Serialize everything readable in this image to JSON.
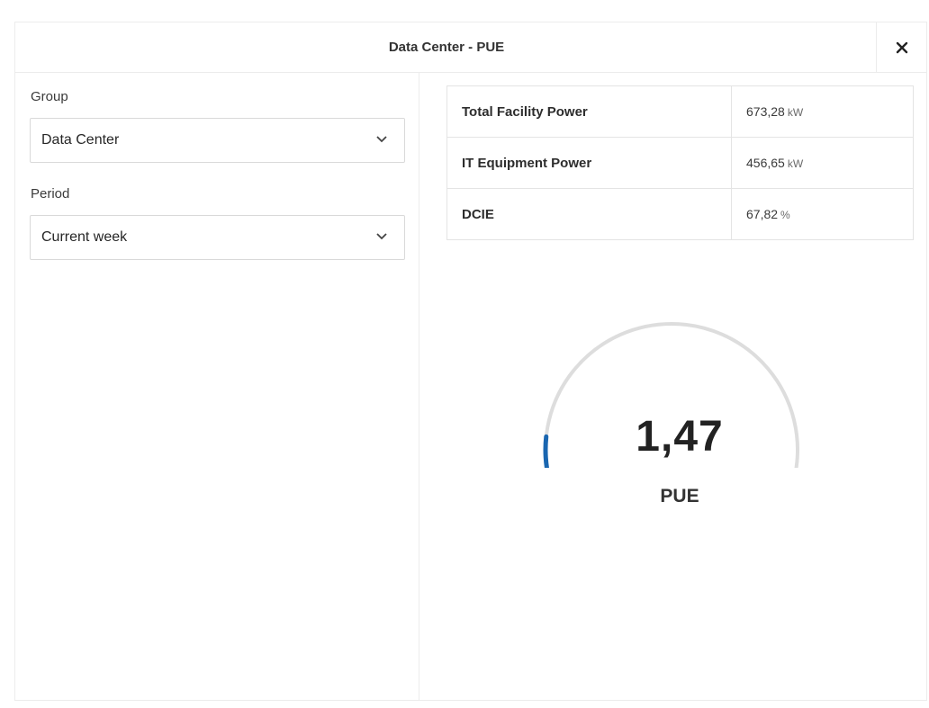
{
  "dialog": {
    "title": "Data Center - PUE",
    "close_icon": "close-icon"
  },
  "filters": {
    "group": {
      "label": "Group",
      "value": "Data Center"
    },
    "period": {
      "label": "Period",
      "value": "Current week"
    }
  },
  "metrics": [
    {
      "name": "Total Facility Power",
      "value": "673,28",
      "unit": "kW"
    },
    {
      "name": "IT Equipment Power",
      "value": "456,65",
      "unit": "kW"
    },
    {
      "name": "DCIE",
      "value": "67,82",
      "unit": "%"
    }
  ],
  "gauge": {
    "value": "1,47",
    "label": "PUE",
    "fill_fraction": 0.08,
    "accent_color": "#1a66b0",
    "track_color": "#dddddd"
  }
}
